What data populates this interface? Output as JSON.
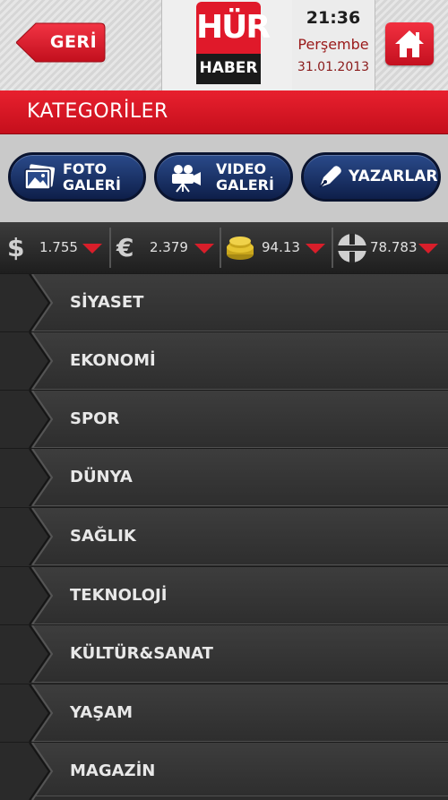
{
  "header": {
    "back_label": "GERİ",
    "logo_top": "HÜR",
    "logo_bottom": "HABER",
    "time": "21:36",
    "day": "Perşembe",
    "date": "31.01.2013"
  },
  "category_bar": {
    "title": "KATEGORİLER"
  },
  "buttons": {
    "foto_line1": "FOTO",
    "foto_line2": "GALERİ",
    "video_line1": "VIDEO",
    "video_line2": "GALERİ",
    "yazarlar": "YAZARLAR"
  },
  "currencies": [
    {
      "symbol": "$",
      "value": "1.755",
      "icon": "dollar-icon"
    },
    {
      "symbol": "€",
      "value": "2.379",
      "icon": "euro-icon"
    },
    {
      "symbol": "",
      "value": "94.13",
      "icon": "gold-icon"
    },
    {
      "symbol": "",
      "value": "78.783",
      "icon": "stock-index-icon"
    }
  ],
  "menu": [
    "SİYASET",
    "EKONOMİ",
    "SPOR",
    "DÜNYA",
    "SAĞLIK",
    "TEKNOLOJİ",
    "KÜLTÜR&SANAT",
    "YAŞAM",
    "MAGAZİN"
  ],
  "colors": {
    "accent_red": "#e0192a",
    "navy": "#0e1f4a",
    "dark": "#2e2e2e"
  }
}
